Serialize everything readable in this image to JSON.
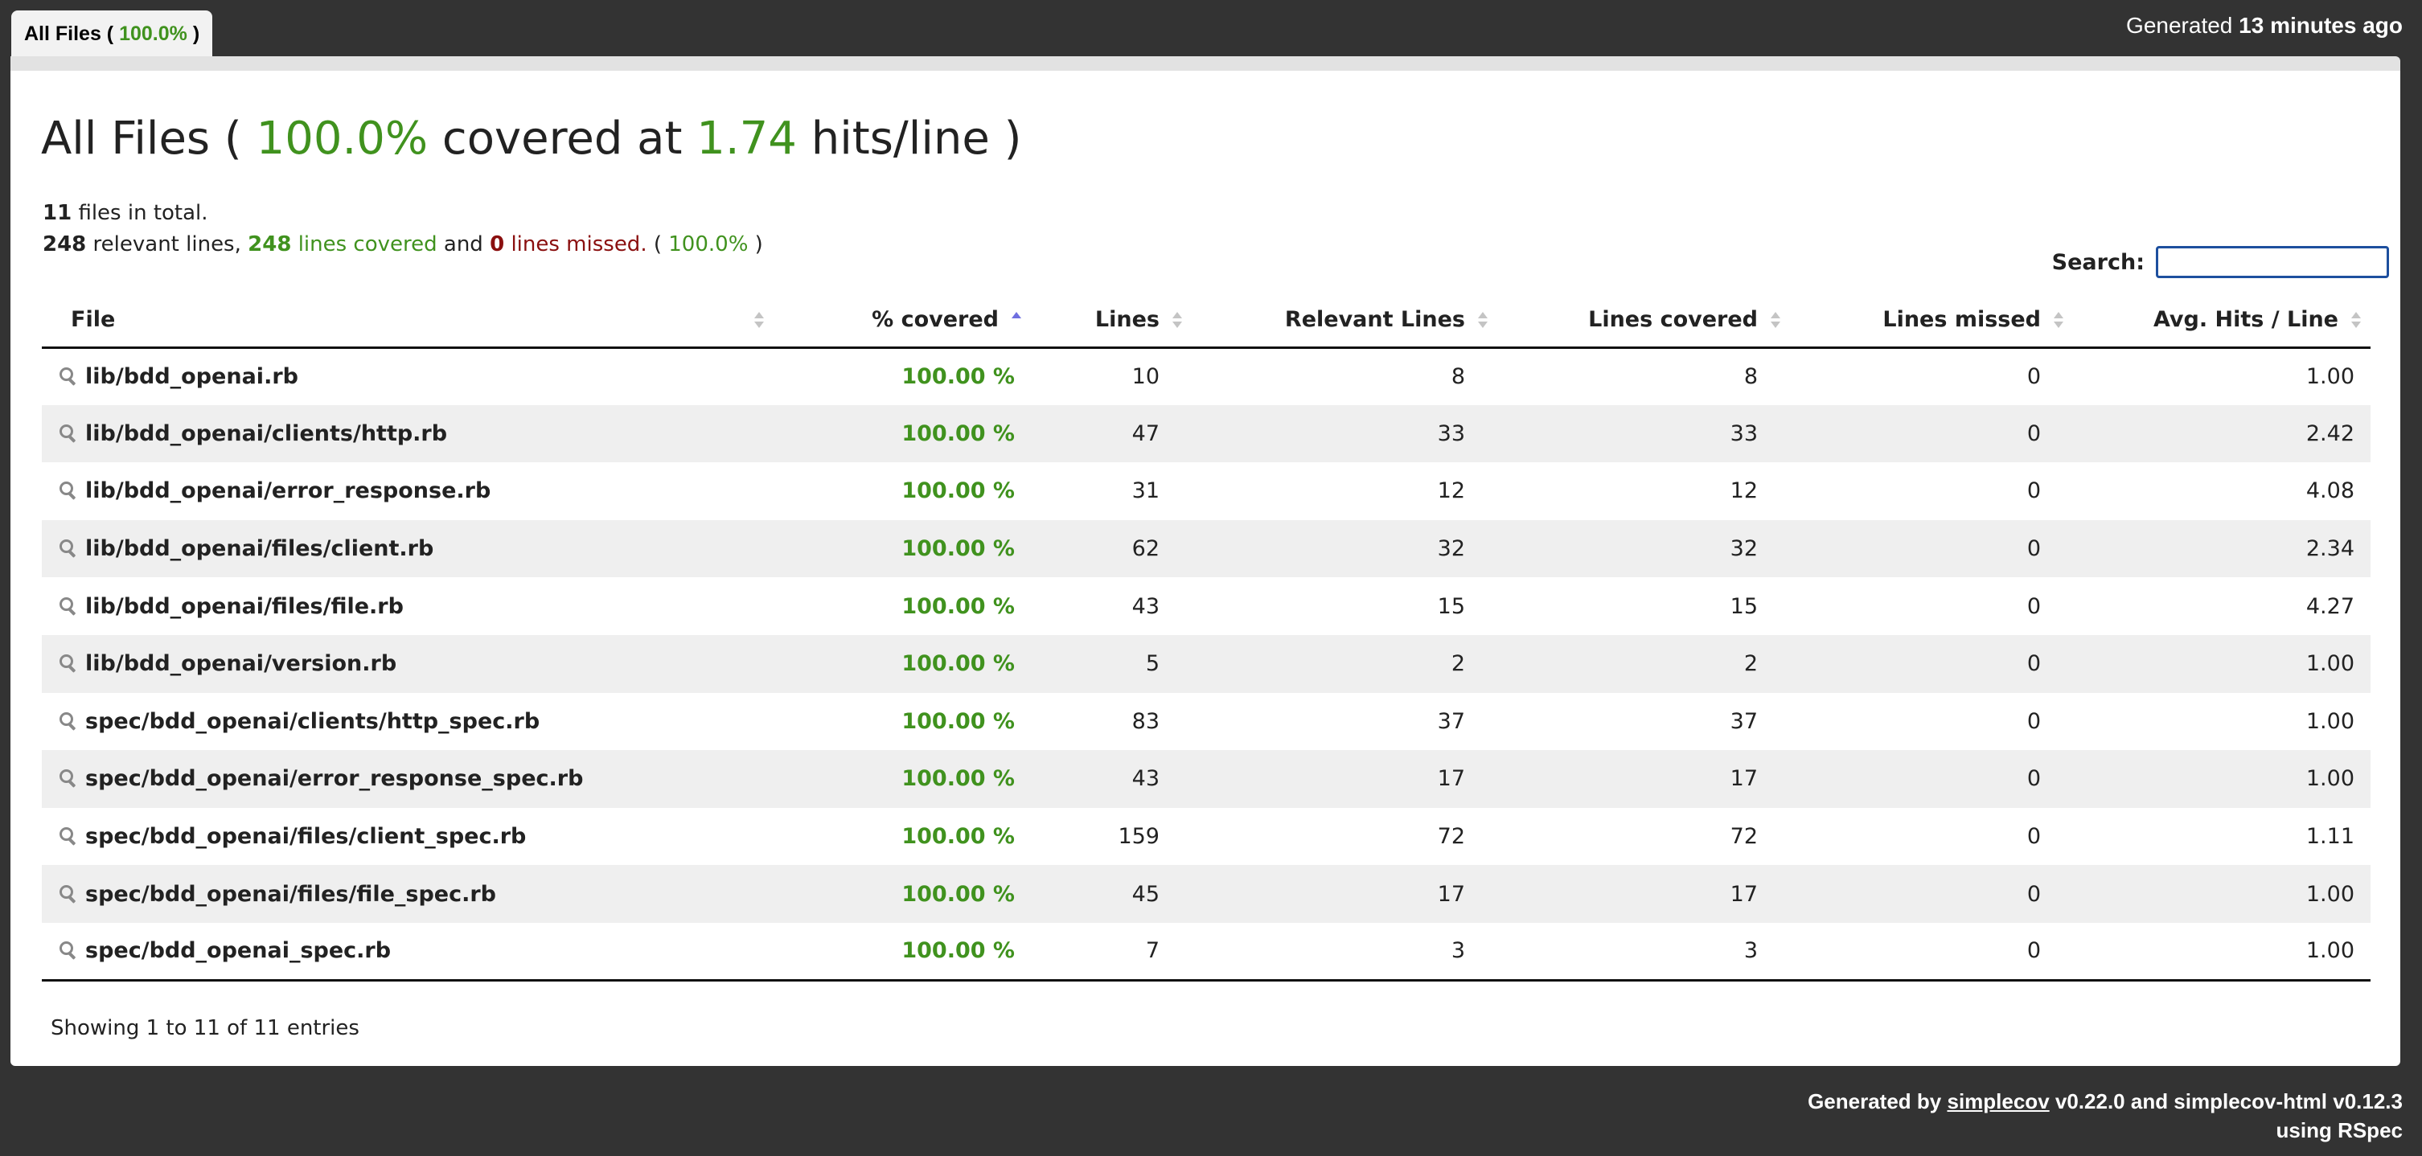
{
  "tab": {
    "prefix": "All Files (",
    "percent": "100.0%",
    "suffix": ")"
  },
  "header": {
    "generated_prefix": "Generated",
    "generated_ago": "13 minutes ago"
  },
  "heading": {
    "prefix": "All Files (",
    "percent": "100.0%",
    "middle": "covered at",
    "hits": "1.74",
    "suffix": "hits/line )"
  },
  "summary": {
    "files_count": "11",
    "files_text": "files in total.",
    "relevant": "248",
    "relevant_text": "relevant lines,",
    "covered": "248",
    "covered_text": "lines covered",
    "and_text": "and",
    "missed": "0",
    "missed_text": "lines missed.",
    "open_paren": "(",
    "percent": "100.0%",
    "close_paren": ")"
  },
  "search": {
    "label": "Search:",
    "value": "",
    "placeholder": ""
  },
  "table": {
    "columns": [
      "File",
      "% covered",
      "Lines",
      "Relevant Lines",
      "Lines covered",
      "Lines missed",
      "Avg. Hits / Line"
    ],
    "rows": [
      {
        "file": "lib/bdd_openai.rb",
        "covered": "100.00 %",
        "lines": "10",
        "relevant": "8",
        "lines_covered": "8",
        "missed": "0",
        "avg": "1.00"
      },
      {
        "file": "lib/bdd_openai/clients/http.rb",
        "covered": "100.00 %",
        "lines": "47",
        "relevant": "33",
        "lines_covered": "33",
        "missed": "0",
        "avg": "2.42"
      },
      {
        "file": "lib/bdd_openai/error_response.rb",
        "covered": "100.00 %",
        "lines": "31",
        "relevant": "12",
        "lines_covered": "12",
        "missed": "0",
        "avg": "4.08"
      },
      {
        "file": "lib/bdd_openai/files/client.rb",
        "covered": "100.00 %",
        "lines": "62",
        "relevant": "32",
        "lines_covered": "32",
        "missed": "0",
        "avg": "2.34"
      },
      {
        "file": "lib/bdd_openai/files/file.rb",
        "covered": "100.00 %",
        "lines": "43",
        "relevant": "15",
        "lines_covered": "15",
        "missed": "0",
        "avg": "4.27"
      },
      {
        "file": "lib/bdd_openai/version.rb",
        "covered": "100.00 %",
        "lines": "5",
        "relevant": "2",
        "lines_covered": "2",
        "missed": "0",
        "avg": "1.00"
      },
      {
        "file": "spec/bdd_openai/clients/http_spec.rb",
        "covered": "100.00 %",
        "lines": "83",
        "relevant": "37",
        "lines_covered": "37",
        "missed": "0",
        "avg": "1.00"
      },
      {
        "file": "spec/bdd_openai/error_response_spec.rb",
        "covered": "100.00 %",
        "lines": "43",
        "relevant": "17",
        "lines_covered": "17",
        "missed": "0",
        "avg": "1.00"
      },
      {
        "file": "spec/bdd_openai/files/client_spec.rb",
        "covered": "100.00 %",
        "lines": "159",
        "relevant": "72",
        "lines_covered": "72",
        "missed": "0",
        "avg": "1.11"
      },
      {
        "file": "spec/bdd_openai/files/file_spec.rb",
        "covered": "100.00 %",
        "lines": "45",
        "relevant": "17",
        "lines_covered": "17",
        "missed": "0",
        "avg": "1.00"
      },
      {
        "file": "spec/bdd_openai_spec.rb",
        "covered": "100.00 %",
        "lines": "7",
        "relevant": "3",
        "lines_covered": "3",
        "missed": "0",
        "avg": "1.00"
      }
    ]
  },
  "info": "Showing 1 to 11 of 11 entries",
  "footer": {
    "generated_by": "Generated by",
    "link": "simplecov",
    "versions": "v0.22.0 and simplecov-html v0.12.3",
    "using": "using RSpec"
  },
  "colors": {
    "covered_green": "#40921e",
    "missed_red": "#8a0f0f",
    "background": "#333333"
  }
}
